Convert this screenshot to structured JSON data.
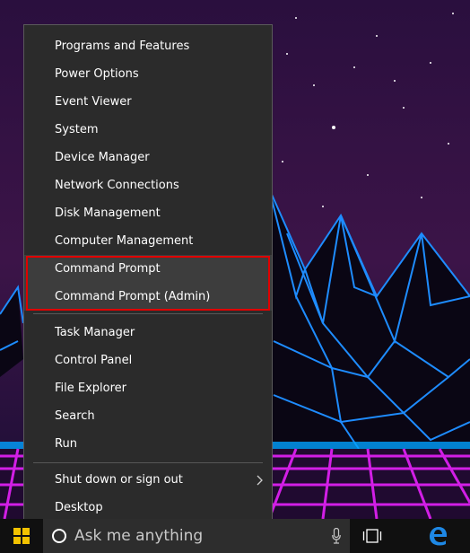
{
  "menu": {
    "groups": [
      {
        "items": [
          {
            "label": "Programs and Features"
          },
          {
            "label": "Power Options"
          },
          {
            "label": "Event Viewer"
          },
          {
            "label": "System"
          },
          {
            "label": "Device Manager"
          },
          {
            "label": "Network Connections"
          },
          {
            "label": "Disk Management"
          },
          {
            "label": "Computer Management"
          },
          {
            "label": "Command Prompt"
          },
          {
            "label": "Command Prompt (Admin)"
          }
        ]
      },
      {
        "items": [
          {
            "label": "Task Manager"
          },
          {
            "label": "Control Panel"
          },
          {
            "label": "File Explorer"
          },
          {
            "label": "Search"
          },
          {
            "label": "Run"
          }
        ]
      },
      {
        "items": [
          {
            "label": "Shut down or sign out",
            "submenu": true
          },
          {
            "label": "Desktop"
          }
        ]
      }
    ],
    "highlighted": [
      "Command Prompt",
      "Command Prompt (Admin)"
    ],
    "highlight_color": "#e00000"
  },
  "taskbar": {
    "search_placeholder": "Ask me anything",
    "icons": [
      "windows-logo-icon",
      "cortana-circle-icon",
      "microphone-icon",
      "task-view-icon",
      "edge-icon"
    ]
  },
  "wallpaper": {
    "theme": "synthwave mountains",
    "colors": {
      "sky": "#1a0a2e",
      "mountain_line": "#1e8cff",
      "grid": "#d21ee6",
      "horizon": "#00a0ff"
    }
  }
}
